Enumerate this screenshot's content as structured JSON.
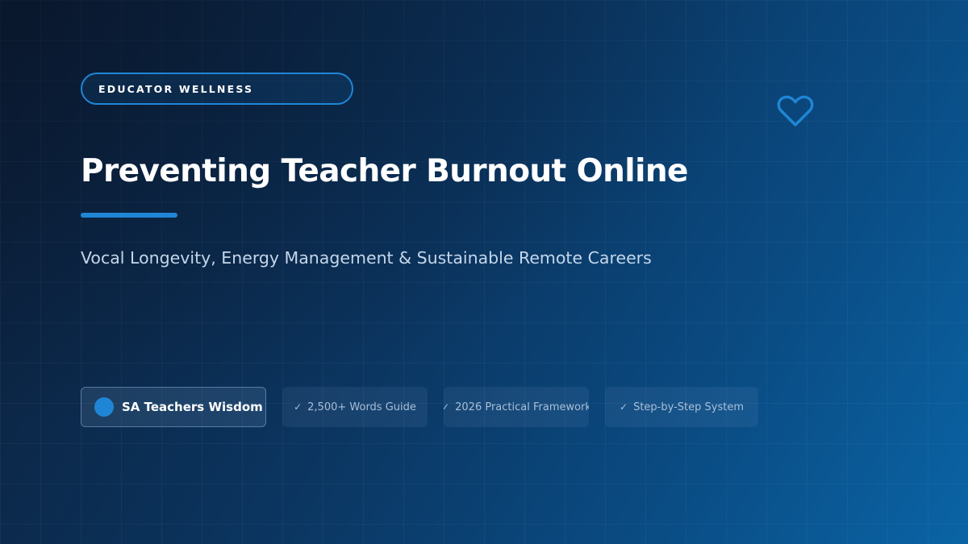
{
  "category": "EDUCATOR WELLNESS",
  "title": "Preventing Teacher Burnout Online",
  "subtitle": "Vocal Longevity, Energy Management & Sustainable Remote Careers",
  "brand": {
    "name": "SA Teachers Wisdom"
  },
  "features": [
    {
      "check": "✓",
      "label": "2,500+ Words Guide"
    },
    {
      "check": "✓",
      "label": "2026 Practical Framework"
    },
    {
      "check": "✓",
      "label": "Step-by-Step System"
    }
  ],
  "icons": {
    "heart": "heart-icon"
  },
  "colors": {
    "accent": "#1f86d6",
    "background_start": "#0c1d36",
    "background_end": "#0a64a5",
    "subtitle_text": "#c5d6ea",
    "feature_text": "#a9bfd8"
  }
}
